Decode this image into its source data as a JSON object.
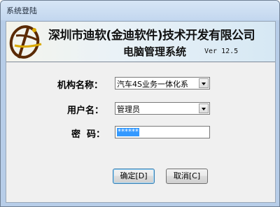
{
  "window": {
    "title": "系统登陆"
  },
  "banner": {
    "company": "深圳市迪软(金迪软件)技术开发有限公司",
    "system": "电脑管理系统",
    "version": "Ver 12.5"
  },
  "form": {
    "org_label": "机构名称：",
    "org_value": "汽车4S业务一体化系",
    "user_label": "用户名：",
    "user_value": "管理员",
    "pwd_label": "密  码：",
    "pwd_value": "******"
  },
  "buttons": {
    "ok": "确定[D]",
    "cancel": "取消[C]"
  },
  "icons": [
    "app-logo-icon",
    "chevron-down-icon"
  ]
}
